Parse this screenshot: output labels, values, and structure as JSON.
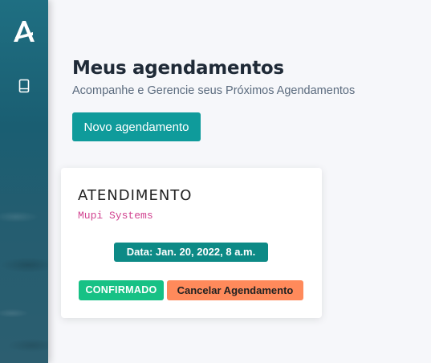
{
  "sidebar": {
    "logo_icon": "brand-a-logo-icon",
    "nav_icon": "book-icon"
  },
  "header": {
    "title": "Meus agendamentos",
    "subtitle": "Acompanhe e Gerencie seus Próximos Agendamentos"
  },
  "actions": {
    "new_label": "Novo agendamento"
  },
  "appointments": [
    {
      "title": "ATENDIMENTO",
      "company": "Mupi Systems",
      "date": "Data: Jan. 20, 2022, 8 a.m.",
      "status": "CONFIRMADO",
      "cancel_label": "Cancelar Agendamento"
    }
  ],
  "colors": {
    "sidebar": "#1f6f82",
    "primary": "#0f9b9b",
    "date_badge": "#0d8a86",
    "confirmed": "#17c185",
    "cancel": "#ff8a5b",
    "company_text": "#d14390"
  }
}
